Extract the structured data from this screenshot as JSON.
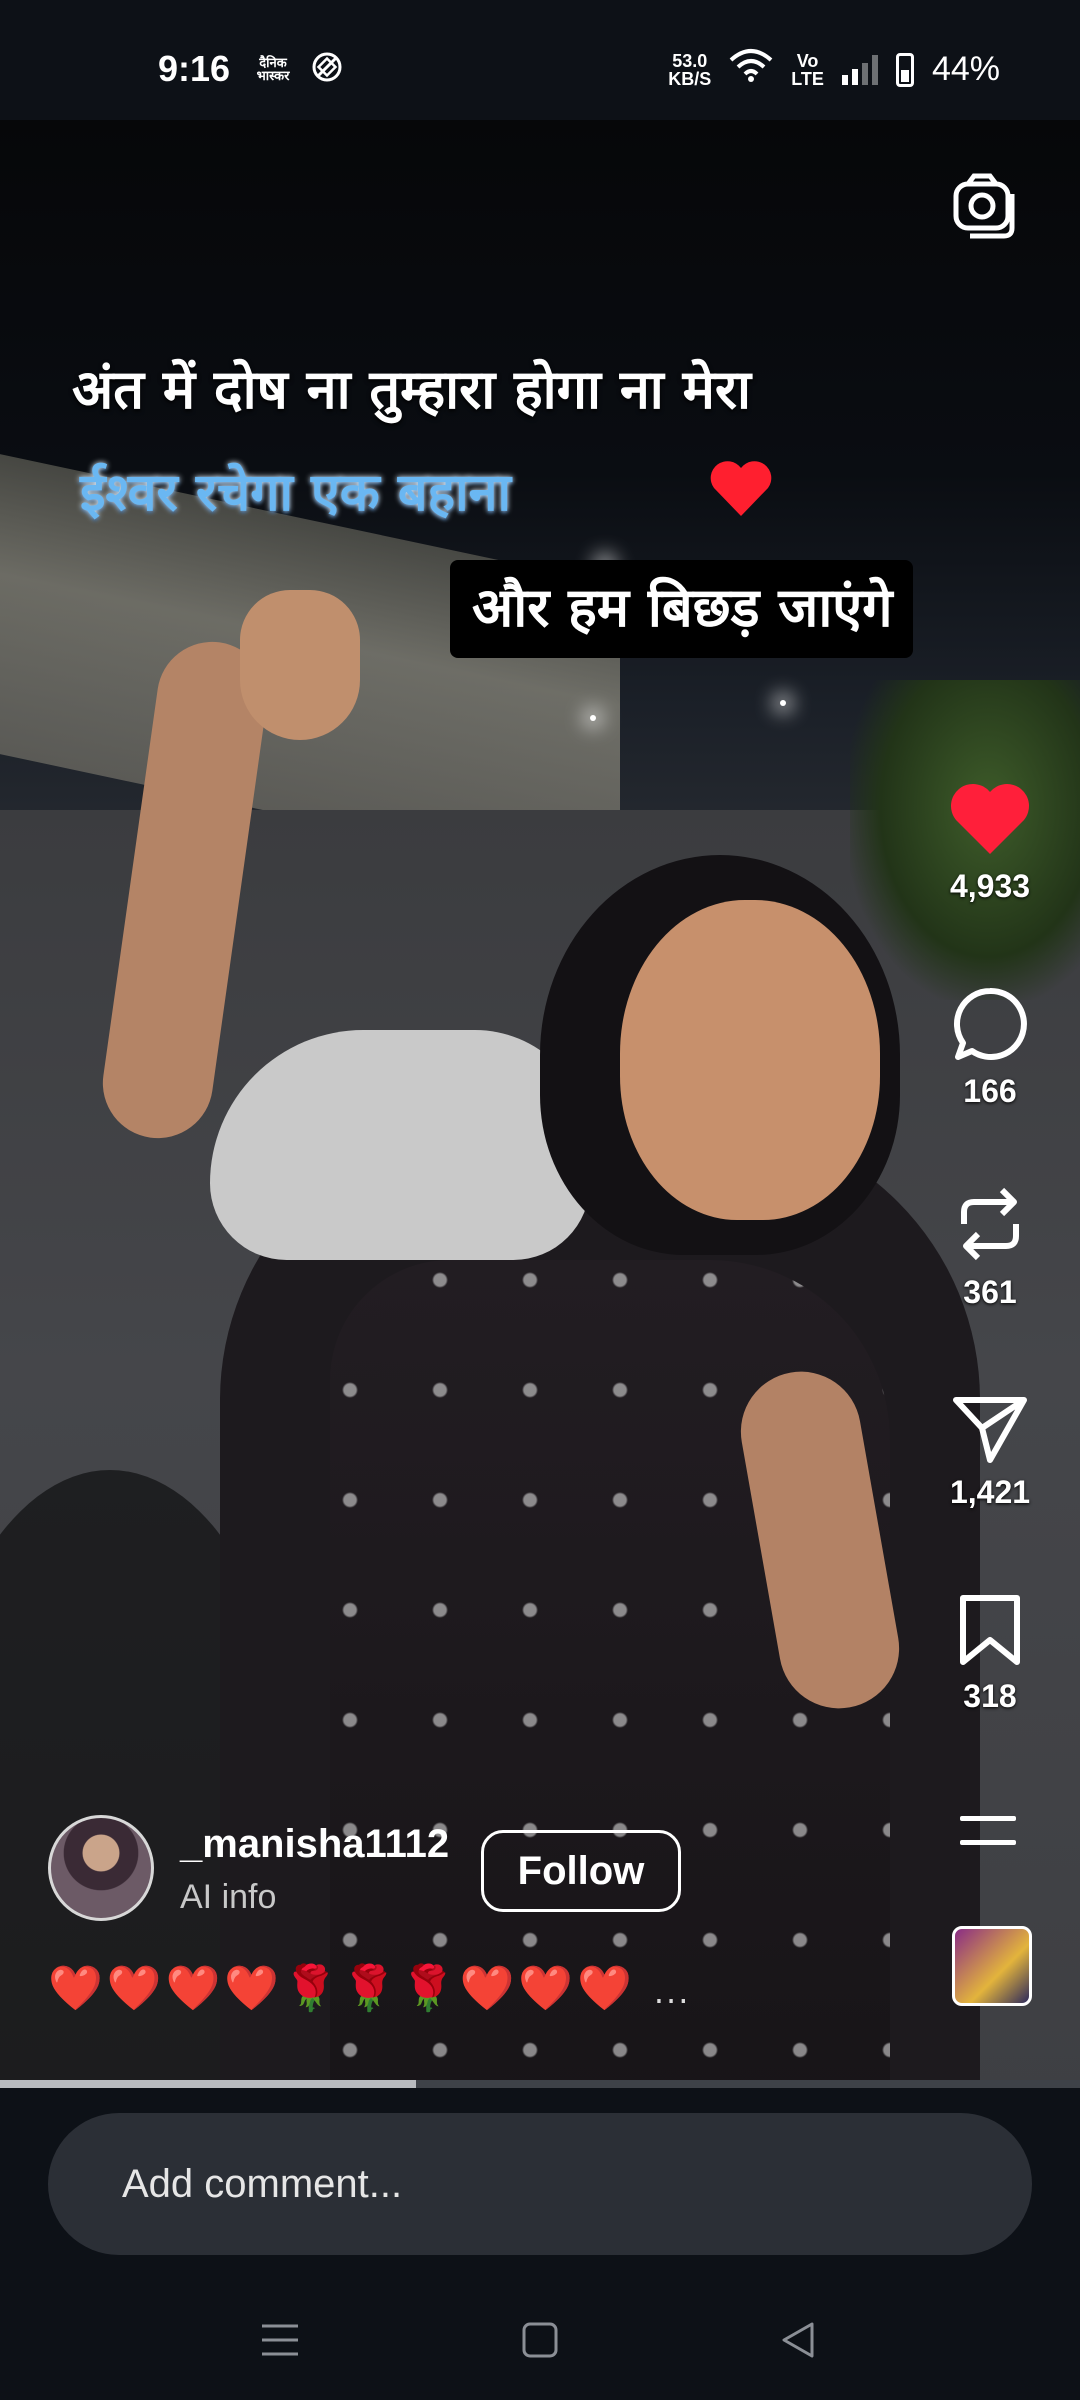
{
  "status_bar": {
    "time": "9:16",
    "app_icon_1": "दैनिक भास्कर",
    "net_speed_value": "53.0",
    "net_speed_unit": "KB/S",
    "network_label_top": "Vo",
    "network_label_bottom": "LTE",
    "battery": "44%"
  },
  "overlay_text": {
    "line1": "अंत में दोष ना तुम्हारा होगा ना मेरा",
    "line2": "ईश्वर रचेगा एक बहाना",
    "line3": "और हम बिछड़ जाएंगे"
  },
  "actions": {
    "likes": "4,933",
    "comments": "166",
    "reposts": "361",
    "shares": "1,421",
    "saves": "318"
  },
  "author": {
    "username": "_manisha1112",
    "subtitle": "AI info",
    "follow_label": "Follow"
  },
  "caption": {
    "emoji": "❤️❤️❤️❤️🌹🌹🌹❤️❤️❤️",
    "more": "..."
  },
  "progress": {
    "fraction": 0.385
  },
  "comment": {
    "placeholder": "Add comment..."
  },
  "icons": {
    "camera": "camera-icon",
    "like": "heart-icon",
    "comment": "comment-bubble-icon",
    "repost": "repost-icon",
    "share": "send-icon",
    "save": "bookmark-icon",
    "menu": "menu-icon",
    "nav_recent": "recents-icon",
    "nav_home": "home-icon",
    "nav_back": "back-icon"
  },
  "colors": {
    "like_red": "#ff1f3a",
    "caption_blue": "#6ab7f2",
    "background": "#0d1117"
  }
}
